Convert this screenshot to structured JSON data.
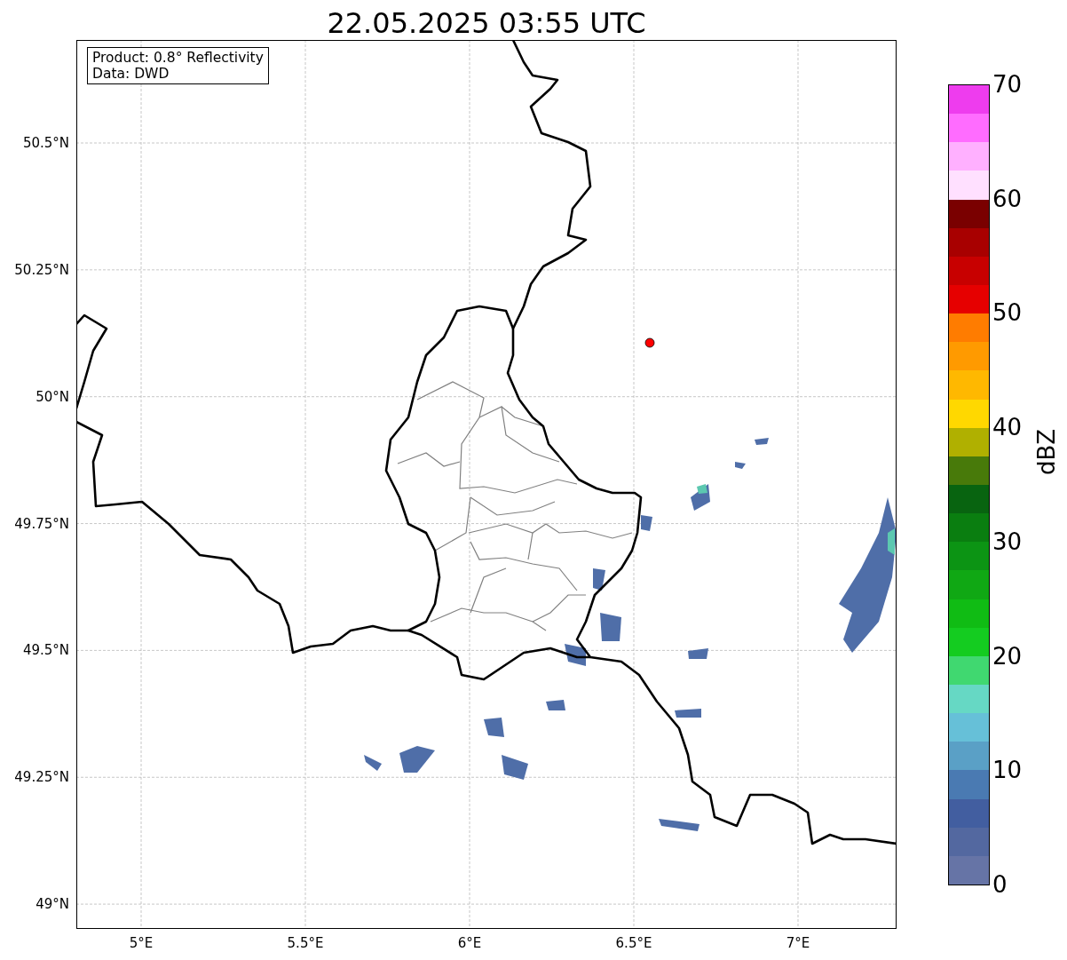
{
  "title": "22.05.2025 03:55 UTC",
  "info_box": {
    "lines": [
      "Product: 0.8° Reflectivity",
      "Data: DWD"
    ]
  },
  "map": {
    "lat_ticks": [
      "50.5°N",
      "50.25°N",
      "50°N",
      "49.75°N",
      "49.5°N",
      "49.25°N",
      "49°N"
    ],
    "lon_ticks": [
      "5°E",
      "5.5°E",
      "6°E",
      "6.5°E",
      "7°E"
    ]
  },
  "colorbar": {
    "label": "dBZ",
    "ticks": [
      "70",
      "60",
      "50",
      "40",
      "30",
      "20",
      "10",
      "0"
    ],
    "segments": [
      {
        "color": "#ee3cee"
      },
      {
        "color": "#ff6cff"
      },
      {
        "color": "#ffb0ff"
      },
      {
        "color": "#ffe0ff"
      },
      {
        "color": "#7a0000"
      },
      {
        "color": "#a80000"
      },
      {
        "color": "#c80000"
      },
      {
        "color": "#e60000"
      },
      {
        "color": "#ff7c00"
      },
      {
        "color": "#ff9a00"
      },
      {
        "color": "#ffb800"
      },
      {
        "color": "#ffd800"
      },
      {
        "color": "#b0b000"
      },
      {
        "color": "#487a0a"
      },
      {
        "color": "#086410"
      },
      {
        "color": "#0a7e10"
      },
      {
        "color": "#0c9414"
      },
      {
        "color": "#10a814"
      },
      {
        "color": "#10bc14"
      },
      {
        "color": "#14cc20"
      },
      {
        "color": "#40d870"
      },
      {
        "color": "#66d8c4"
      },
      {
        "color": "#66c0d8"
      },
      {
        "color": "#5aa0c6"
      },
      {
        "color": "#4a7ab2"
      },
      {
        "color": "#425ea0"
      },
      {
        "color": "#5368a0"
      },
      {
        "color": "#6674a6"
      }
    ]
  }
}
